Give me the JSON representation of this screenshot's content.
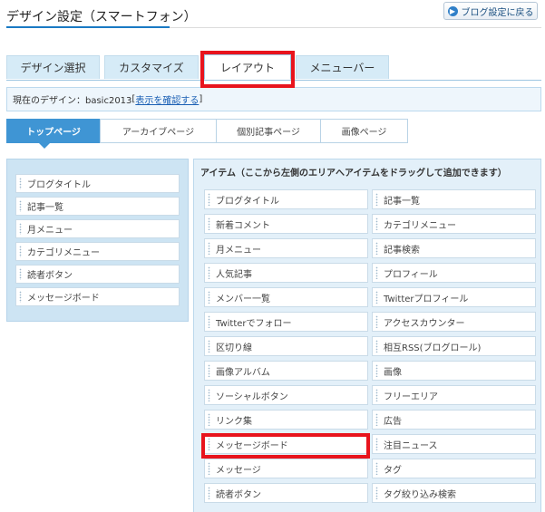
{
  "header": {
    "title": "デザイン設定（スマートフォン）",
    "back_button": "ブログ設定に戻る",
    "back_icon": "circle-arrow-icon"
  },
  "main_tabs": [
    {
      "label": "デザイン選択"
    },
    {
      "label": "カスタマイズ"
    },
    {
      "label": "レイアウト"
    },
    {
      "label": "メニューバー"
    }
  ],
  "current_design": {
    "prefix": "現在のデザイン：basic2013",
    "bracket_open": "[",
    "link": "表示を確認する",
    "bracket_close": "]"
  },
  "sub_tabs": [
    {
      "label": "トップページ"
    },
    {
      "label": "アーカイブページ"
    },
    {
      "label": "個別記事ページ"
    },
    {
      "label": "画像ページ"
    }
  ],
  "left_area": {
    "items": [
      "ブログタイトル",
      "記事一覧",
      "月メニュー",
      "カテゴリメニュー",
      "読者ボタン",
      "メッセージボード"
    ]
  },
  "items_area": {
    "header": "アイテム（ここから左側のエリアへアイテムをドラッグして追加できます）",
    "items": [
      "ブログタイトル",
      "記事一覧",
      "新着コメント",
      "カテゴリメニュー",
      "月メニュー",
      "記事検索",
      "人気記事",
      "プロフィール",
      "メンバー一覧",
      "Twitterプロフィール",
      "Twitterでフォロー",
      "アクセスカウンター",
      "区切り線",
      "相互RSS(ブログロール)",
      "画像アルバム",
      "画像",
      "ソーシャルボタン",
      "フリーエリア",
      "リンク集",
      "広告",
      "メッセージボード",
      "注目ニュース",
      "メッセージ",
      "タグ",
      "読者ボタン",
      "タグ絞り込み検索"
    ]
  },
  "colors": {
    "accent": "#3f95d4",
    "highlight": "#e8141d",
    "panel": "#cde4f3"
  }
}
